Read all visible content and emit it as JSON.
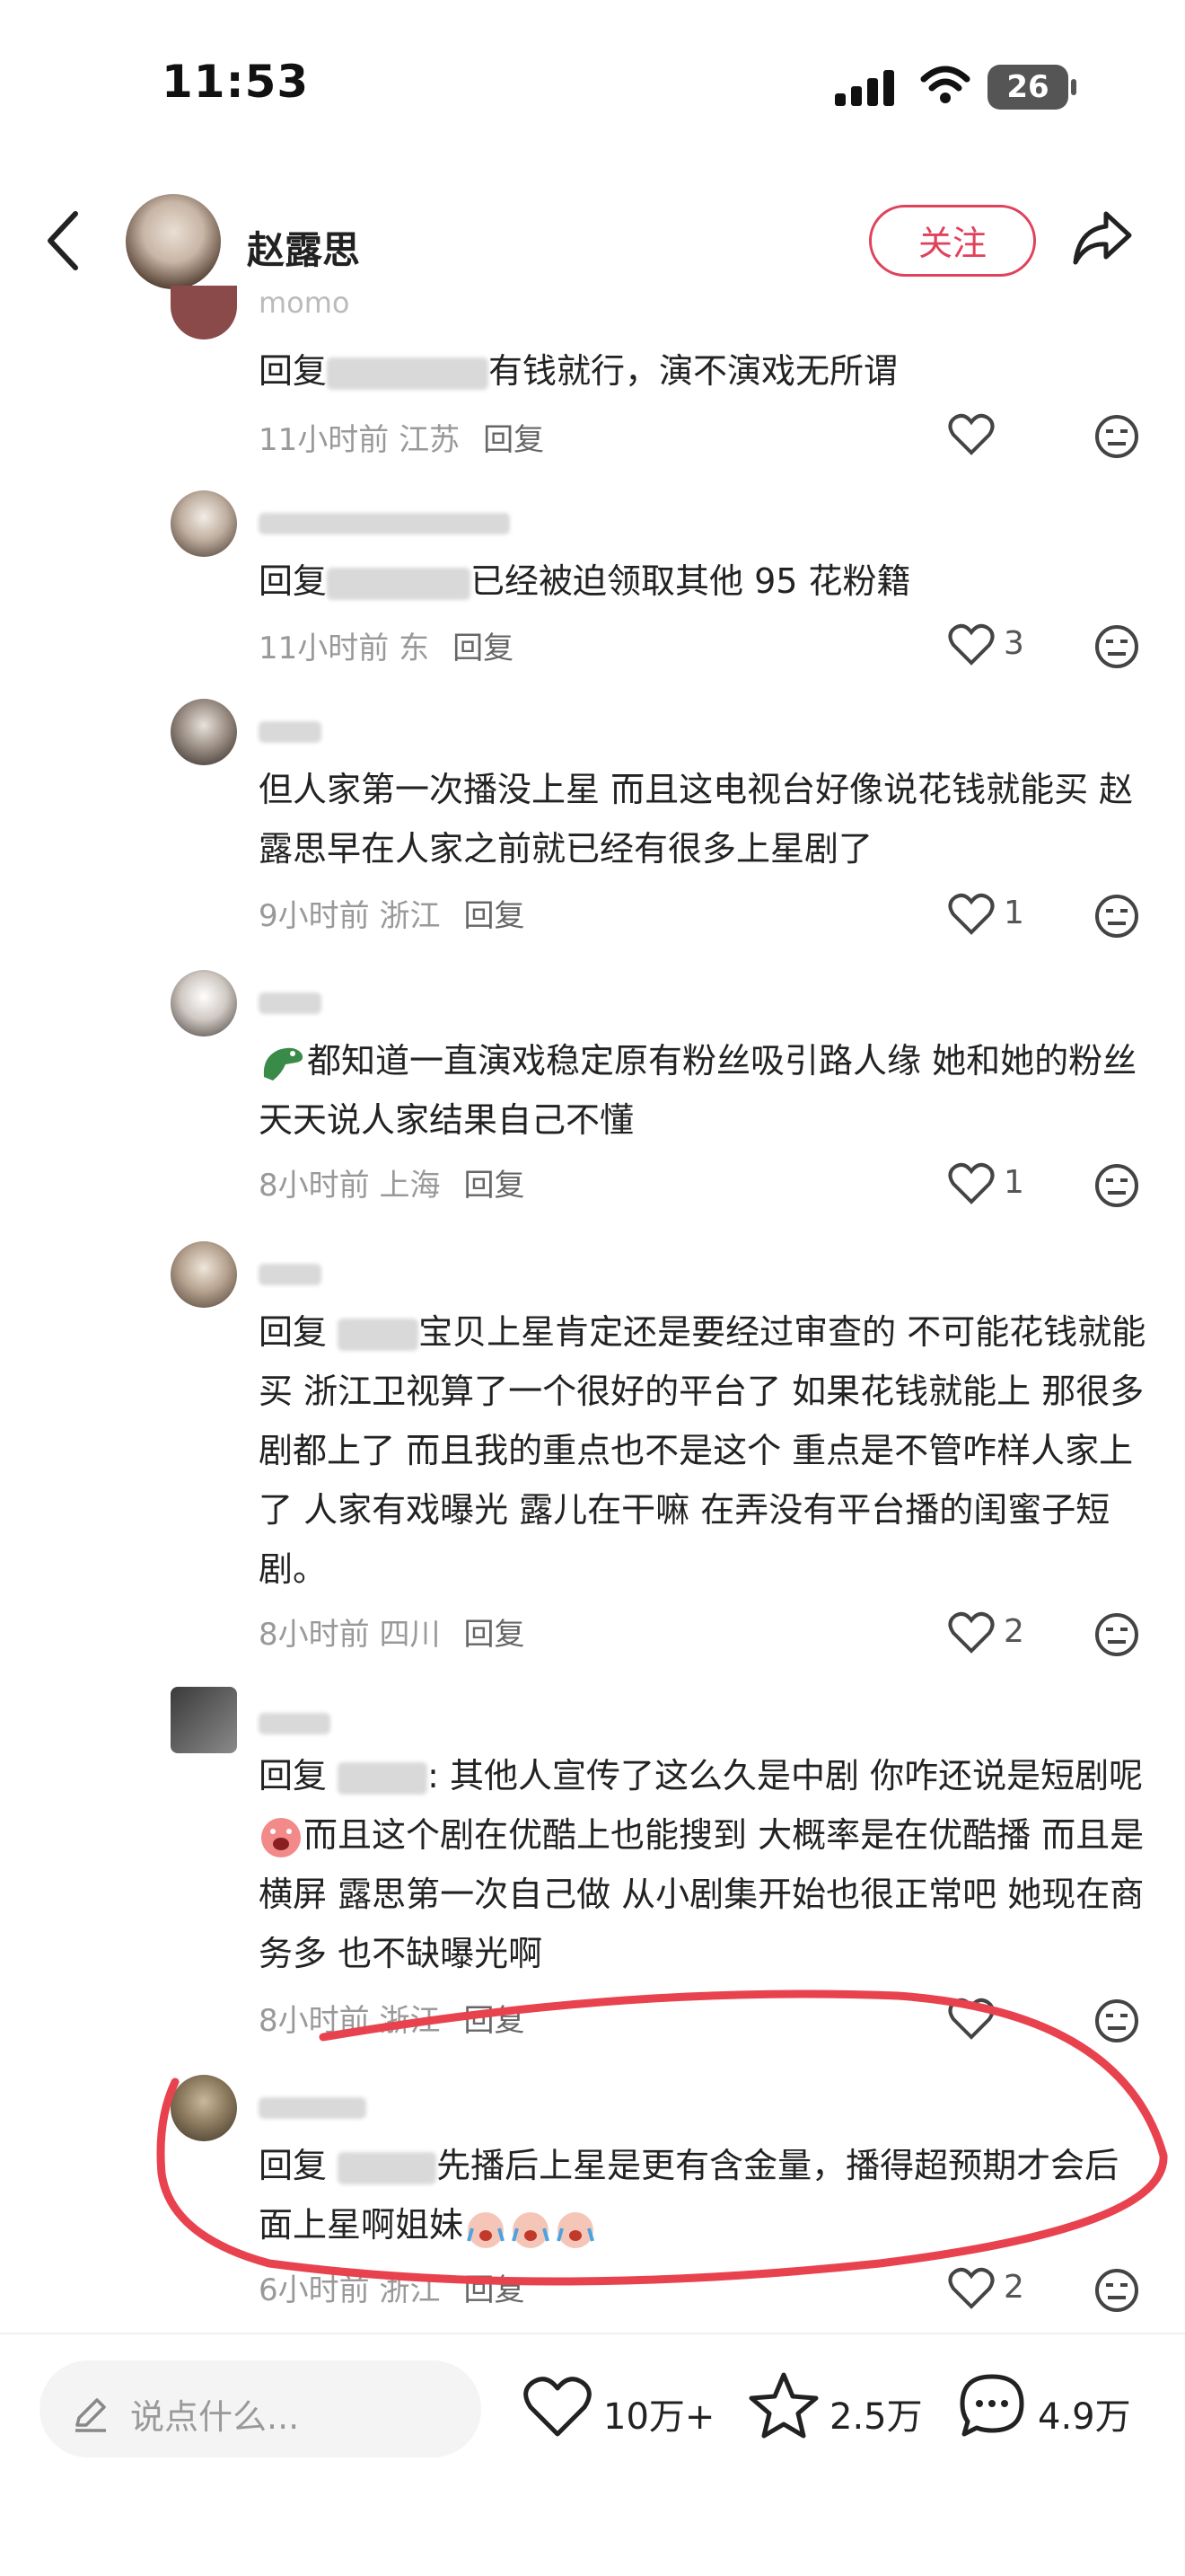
{
  "status_bar": {
    "time": "11:53",
    "battery": "26"
  },
  "header": {
    "user_name": "赵露思",
    "follow_label": "关注"
  },
  "comments": [
    {
      "name": "momo",
      "text_pre": "回复",
      "text": "有钱就行，演不演戏无所谓",
      "time": "11小时前",
      "location": "江苏",
      "reply": "回复",
      "likes": ""
    },
    {
      "name": "",
      "text_pre": "回复",
      "text": "已经被迫领取其他 95 花粉籍",
      "time": "11小时前",
      "location": "东",
      "reply": "回复",
      "likes": "3"
    },
    {
      "name": "",
      "text": "但人家第一次播没上星 而且这电视台好像说花钱就能买 赵露思早在人家之前就已经有很多上星剧了",
      "time": "9小时前",
      "location": "浙江",
      "reply": "回复",
      "likes": "1"
    },
    {
      "name": "",
      "text": "都知道一直演戏稳定原有粉丝吸引路人缘 她和她的粉丝天天说人家结果自己不懂",
      "time": "8小时前",
      "location": "上海",
      "reply": "回复",
      "likes": "1"
    },
    {
      "name": "",
      "text_pre": "回复",
      "text": "宝贝上星肯定还是要经过审查的 不可能花钱就能买 浙江卫视算了一个很好的平台了 如果花钱就能上 那很多剧都上了 而且我的重点也不是这个 重点是不管咋样人家上了 人家有戏曝光 露儿在干嘛 在弄没有平台播的闺蜜子短剧。",
      "time": "8小时前",
      "location": "四川",
      "reply": "回复",
      "likes": "2"
    },
    {
      "name": "",
      "text_pre": "回复",
      "text_a": ": 其他人宣传了这么久是中剧 你咋还说是短剧呢",
      "text_b": "而且这个剧在优酷上也能搜到 大概率是在优酷播 而且是横屏 露思第一次自己做 从小剧集开始也很正常吧 她现在商务多 也不缺曝光啊",
      "time": "8小时前",
      "location": "浙江",
      "reply": "回复",
      "likes": ""
    },
    {
      "name": "",
      "text_pre": "回复",
      "text": "先播后上星是更有含金量，播得超预期才会后面上星啊姐妹",
      "time": "6小时前",
      "location": "浙江",
      "reply": "回复",
      "likes": "2"
    }
  ],
  "bottom_bar": {
    "input_placeholder": "说点什么...",
    "likes": "10万+",
    "favorites": "2.5万",
    "comments": "4.9万"
  },
  "colors": {
    "accent": "#e0425b",
    "annotation": "#e8424f"
  }
}
